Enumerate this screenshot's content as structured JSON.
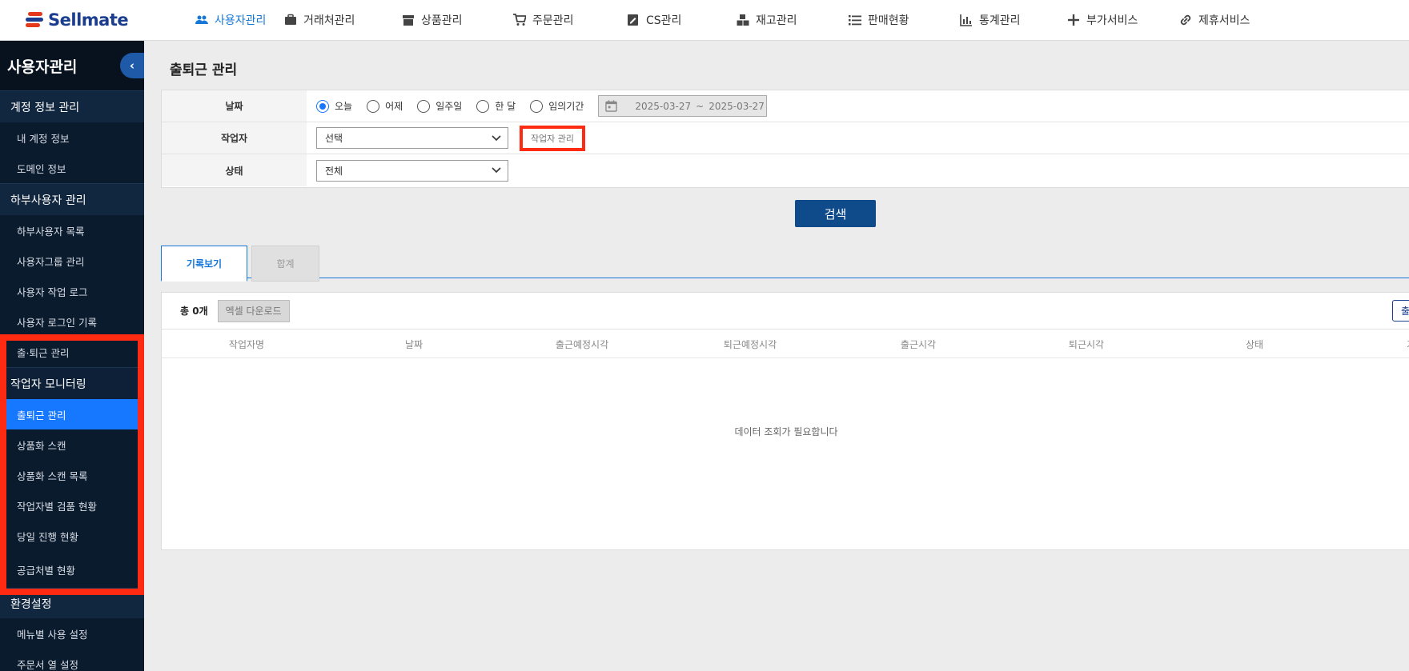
{
  "brand": {
    "name": "Sellmate"
  },
  "topnav": [
    {
      "label": "사용자관리",
      "icon": "users-icon",
      "active": true
    },
    {
      "label": "거래처관리",
      "icon": "briefcase-icon"
    },
    {
      "label": "상품관리",
      "icon": "box-icon"
    },
    {
      "label": "주문관리",
      "icon": "cart-icon"
    },
    {
      "label": "CS관리",
      "icon": "edit-note-icon"
    },
    {
      "label": "재고관리",
      "icon": "boxes-icon"
    },
    {
      "label": "판매현황",
      "icon": "list-icon"
    },
    {
      "label": "통계관리",
      "icon": "bar-chart-icon"
    },
    {
      "label": "부가서비스",
      "icon": "plus-icon"
    },
    {
      "label": "제휴서비스",
      "icon": "link-icon"
    }
  ],
  "sidebar": {
    "title": "사용자관리",
    "collapse_icon": "chevron-left-icon",
    "groups": [
      {
        "label": "계정 정보 관리",
        "items": [
          "내 계정 정보",
          "도메인 정보"
        ]
      },
      {
        "label": "하부사용자 관리",
        "items": [
          "하부사용자 목록",
          "사용자그룹 관리",
          "사용자 작업 로그",
          "사용자 로그인 기록",
          "출·퇴근 관리"
        ]
      },
      {
        "label": "작업자 모니터링",
        "items": [
          "출퇴근 관리",
          "상품화 스캔",
          "상품화 스캔 목록",
          "작업자별 검품 현황",
          "당일 진행 현황",
          "공급처별 현황"
        ]
      },
      {
        "label": "환경설정",
        "items": [
          "메뉴별 사용 설정",
          "주문서 열 설정"
        ]
      }
    ]
  },
  "page": {
    "title": "출퇴근 관리"
  },
  "filter": {
    "date_label": "날짜",
    "date_options": [
      "오늘",
      "어제",
      "일주일",
      "한 달",
      "임의기간"
    ],
    "date_selected": "오늘",
    "date_from": "2025-03-27",
    "date_sep": "~",
    "date_to": "2025-03-27",
    "worker_label": "작업자",
    "worker_value": "선택",
    "worker_manage": "작업자 관리",
    "status_label": "상태",
    "status_value": "전체"
  },
  "search_button": "검색",
  "tabs": [
    "기록보기",
    "합계"
  ],
  "result": {
    "total": "총 0개",
    "excel": "엑셀 다운로드",
    "right_button": "출근",
    "columns": [
      "작업자명",
      "날짜",
      "출근예정시각",
      "퇴근예정시각",
      "출근시각",
      "퇴근시각",
      "상태",
      "기타"
    ],
    "empty": "데이터 조회가 필요합니다"
  },
  "colors": {
    "accent": "#1677ff",
    "brand_navy": "#1a3d8f",
    "highlight": "#ff2a12",
    "search": "#0f4a8a"
  }
}
